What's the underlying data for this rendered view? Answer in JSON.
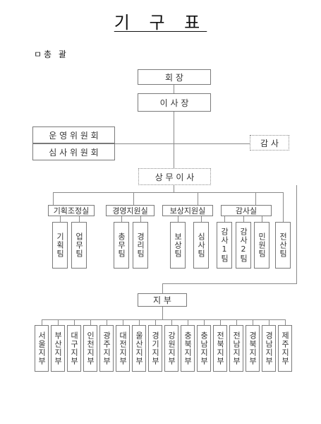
{
  "title": "기 구 표",
  "section_label": "ㅁ총  괄",
  "nodes": {
    "chairman": "회    장",
    "president": "이 사 장",
    "committee_operation": "운 영 위 원 회",
    "committee_review": "심 사 위 원 회",
    "auditor": "감 사",
    "managing_director": "상 무 이 사"
  },
  "offices": [
    "기획조정실",
    "경영지원실",
    "보상지원실",
    "감사실"
  ],
  "teams": [
    "기획팀",
    "업무팀",
    "총무팀",
    "경리팀",
    "보상팀",
    "심사팀",
    "감사1팀",
    "감사2팀",
    "민원팀",
    "전산팀"
  ],
  "branch_head": "지    부",
  "branches": [
    "서울지부",
    "부산지부",
    "대구지부",
    "인천지부",
    "광주지부",
    "대전지부",
    "울산지부",
    "경기지부",
    "강원지부",
    "충북지부",
    "충남지부",
    "전북지부",
    "전남지부",
    "경북지부",
    "경남지부",
    "제주지부"
  ]
}
